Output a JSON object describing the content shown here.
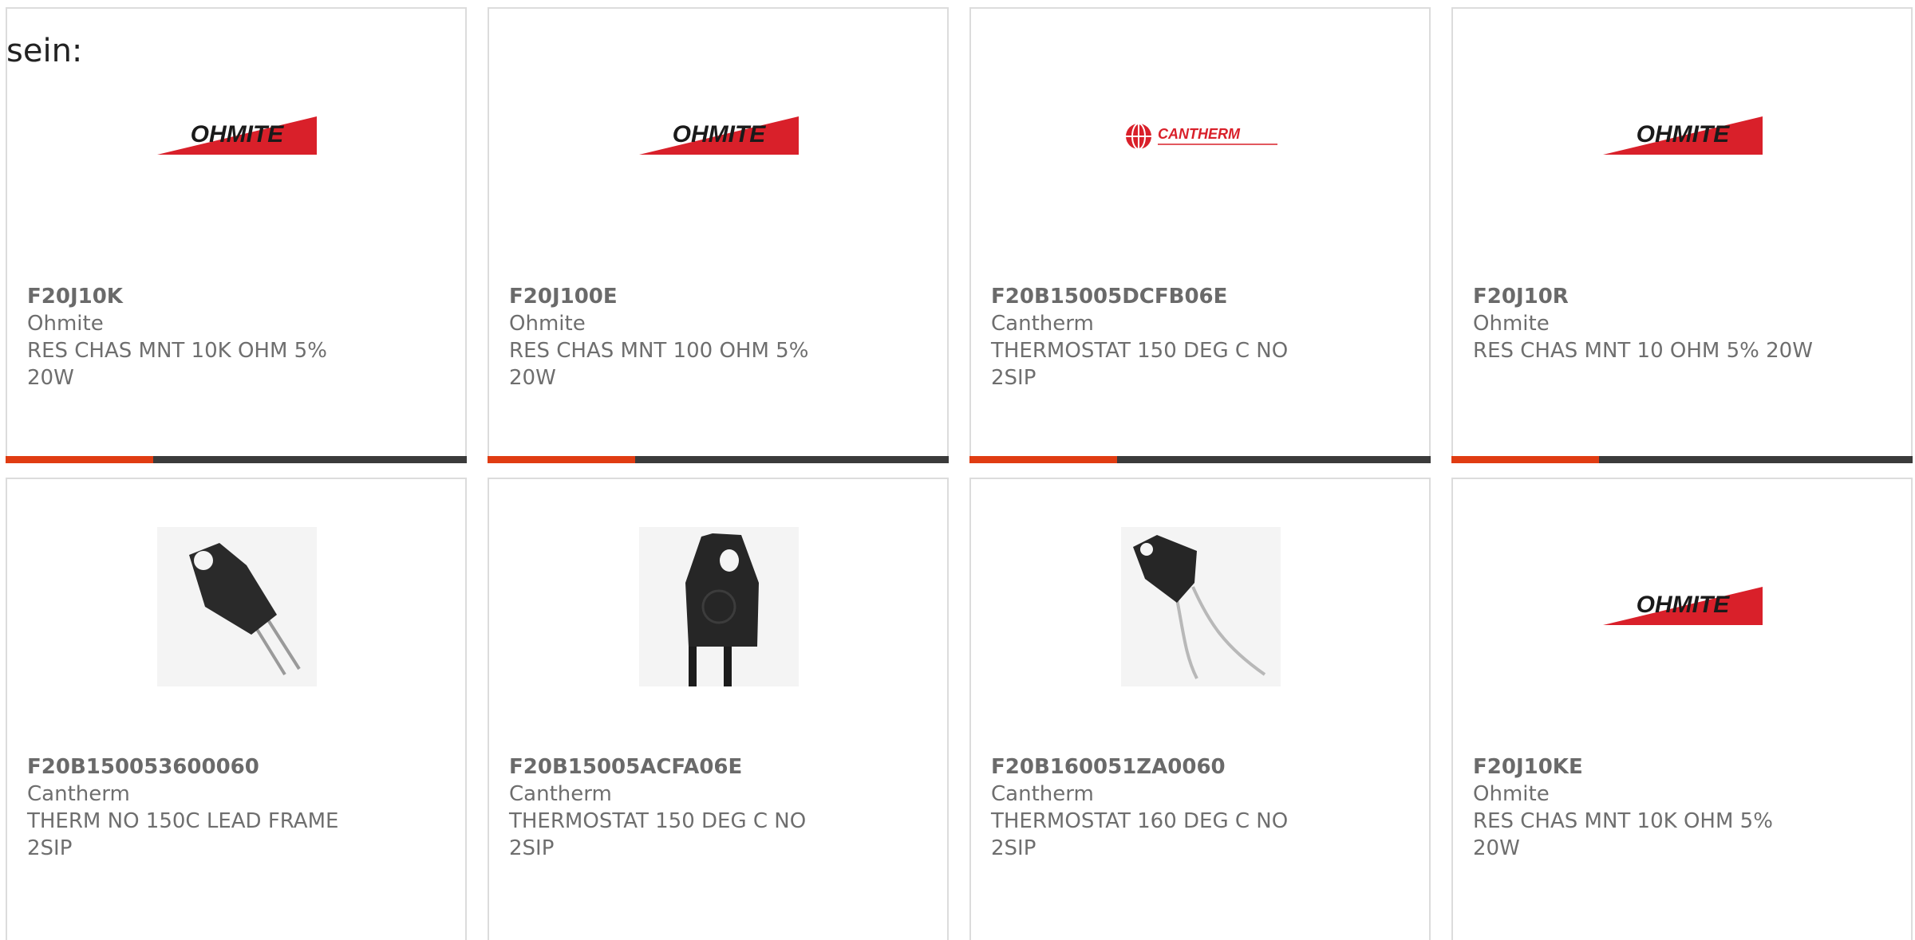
{
  "intro_text": "sein:",
  "colors": {
    "accent": "#e03c12",
    "bar_track": "#3b3b3b",
    "card_border": "#dcdcdc",
    "text": "#6e6e6e"
  },
  "cards": [
    {
      "part_number": "F20J10K",
      "manufacturer": "Ohmite",
      "description": "RES CHAS MNT 10K OHM 5%",
      "description_line2": "20W",
      "image": "ohmite-logo",
      "logo_text": "OHMITE",
      "progress": 0.32
    },
    {
      "part_number": "F20J100E",
      "manufacturer": "Ohmite",
      "description": "RES CHAS MNT 100 OHM 5%",
      "description_line2": "20W",
      "image": "ohmite-logo",
      "logo_text": "OHMITE",
      "progress": 0.32
    },
    {
      "part_number": "F20B15005DCFB06E",
      "manufacturer": "Cantherm",
      "description": "THERMOSTAT 150 DEG C NO",
      "description_line2": "2SIP",
      "image": "cantherm-logo",
      "logo_text": "CANTHERM",
      "progress": 0.32
    },
    {
      "part_number": "F20J10R",
      "manufacturer": "Ohmite",
      "description": "RES CHAS MNT 10 OHM 5% 20W",
      "description_line2": "",
      "image": "ohmite-logo",
      "logo_text": "OHMITE",
      "progress": 0.32
    },
    {
      "part_number": "F20B150053600060",
      "manufacturer": "Cantherm",
      "description": "THERM NO 150C LEAD FRAME",
      "description_line2": "2SIP",
      "image": "thermostat-photo-angled"
    },
    {
      "part_number": "F20B15005ACFA06E",
      "manufacturer": "Cantherm",
      "description": "THERMOSTAT 150 DEG C NO",
      "description_line2": "2SIP",
      "image": "thermostat-photo-front"
    },
    {
      "part_number": "F20B160051ZA0060",
      "manufacturer": "Cantherm",
      "description": "THERMOSTAT 160 DEG C NO",
      "description_line2": "2SIP",
      "image": "thermostat-photo-leads"
    },
    {
      "part_number": "F20J10KE",
      "manufacturer": "Ohmite",
      "description": "RES CHAS MNT 10K OHM 5%",
      "description_line2": "20W",
      "image": "ohmite-logo",
      "logo_text": "OHMITE"
    }
  ]
}
